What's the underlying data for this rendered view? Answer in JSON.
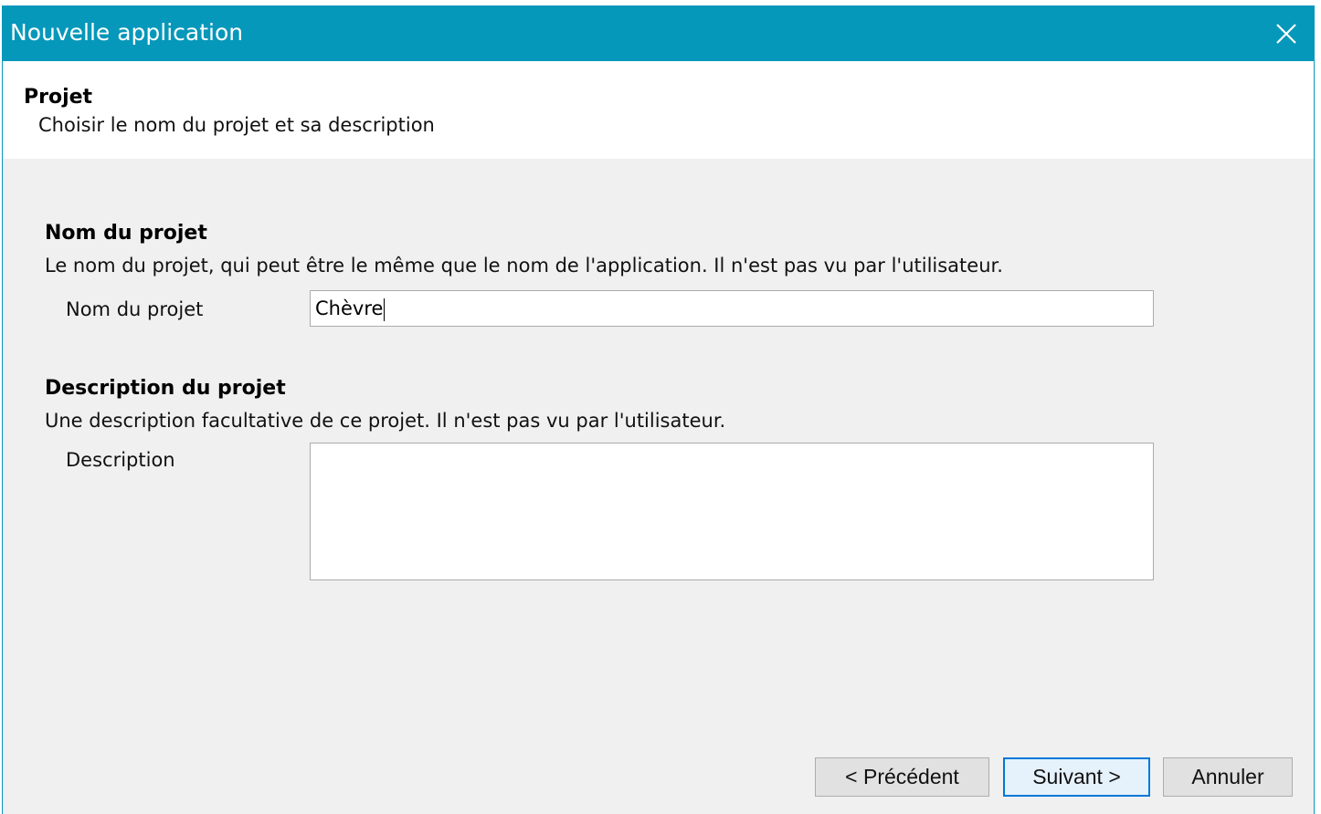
{
  "window": {
    "title": "Nouvelle application"
  },
  "header": {
    "title": "Projet",
    "subtitle": "Choisir le nom du projet et sa description"
  },
  "name_section": {
    "title": "Nom du projet",
    "description": "Le nom du projet, qui peut être le même que le nom de l'application. Il n'est pas vu par l'utilisateur.",
    "field_label": "Nom du projet",
    "field_value": "Chèvre"
  },
  "description_section": {
    "title": "Description du projet",
    "description": "Une description facultative de ce projet. Il n'est pas vu par l'utilisateur.",
    "field_label": "Description",
    "field_value": ""
  },
  "buttons": {
    "previous": "< Précédent",
    "next": "Suivant >",
    "cancel": "Annuler"
  },
  "colors": {
    "titlebar": "#0698ba",
    "primary_button_border": "#0078d7"
  },
  "icons": {
    "close": "close-icon"
  }
}
